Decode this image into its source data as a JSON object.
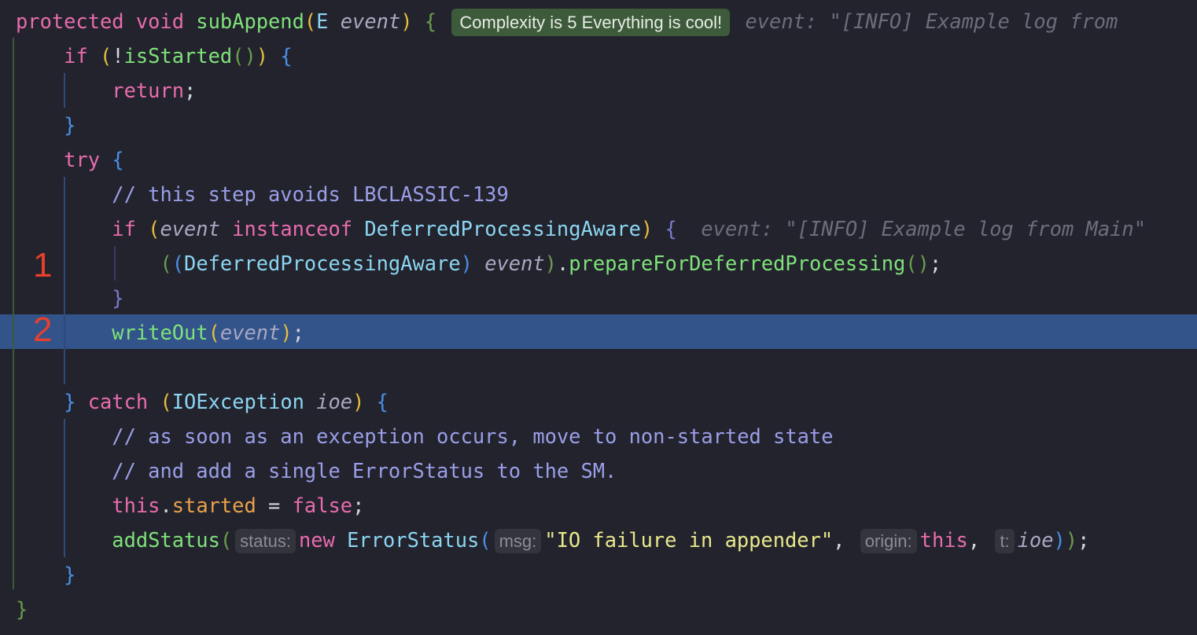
{
  "colors": {
    "background": "#23232d",
    "current_line": "#32548a",
    "marker": "#e8402c"
  },
  "markers": [
    "1",
    "2"
  ],
  "lines": [
    {
      "tokens": [
        {
          "c": "kw",
          "t": "protected void "
        },
        {
          "c": "fn",
          "t": "subAppend"
        },
        {
          "c": "b1",
          "t": "("
        },
        {
          "c": "ty",
          "t": "E "
        },
        {
          "c": "pa",
          "t": "event"
        },
        {
          "c": "b1",
          "t": ")"
        },
        {
          "c": "p",
          "t": " "
        },
        {
          "c": "b2",
          "t": "{"
        },
        {
          "c": "p",
          "t": " "
        },
        {
          "c": "badge",
          "t": "Complexity is 5 Everything is cool!"
        },
        {
          "c": "p",
          "t": " "
        },
        {
          "c": "gh",
          "t": "event: \"[INFO] Example log from"
        }
      ]
    },
    {
      "tokens": [
        {
          "c": "p",
          "t": "    "
        },
        {
          "c": "kw",
          "t": "if "
        },
        {
          "c": "b1",
          "t": "("
        },
        {
          "c": "p",
          "t": "!"
        },
        {
          "c": "fn",
          "t": "isStarted"
        },
        {
          "c": "b2",
          "t": "()"
        },
        {
          "c": "b1",
          "t": ")"
        },
        {
          "c": "p",
          "t": " "
        },
        {
          "c": "b3",
          "t": "{"
        }
      ]
    },
    {
      "tokens": [
        {
          "c": "p",
          "t": "        "
        },
        {
          "c": "kw",
          "t": "return"
        },
        {
          "c": "p",
          "t": ";"
        }
      ]
    },
    {
      "tokens": [
        {
          "c": "p",
          "t": "    "
        },
        {
          "c": "b3",
          "t": "}"
        }
      ]
    },
    {
      "tokens": [
        {
          "c": "p",
          "t": "    "
        },
        {
          "c": "kw",
          "t": "try "
        },
        {
          "c": "b3",
          "t": "{"
        }
      ]
    },
    {
      "tokens": [
        {
          "c": "p",
          "t": "        "
        },
        {
          "c": "cm",
          "t": "// this step avoids LBCLASSIC-139"
        }
      ]
    },
    {
      "tokens": [
        {
          "c": "p",
          "t": "        "
        },
        {
          "c": "kw",
          "t": "if "
        },
        {
          "c": "b1",
          "t": "("
        },
        {
          "c": "pa",
          "t": "event"
        },
        {
          "c": "kw",
          "t": " instanceof "
        },
        {
          "c": "ty",
          "t": "DeferredProcessingAware"
        },
        {
          "c": "b1",
          "t": ")"
        },
        {
          "c": "p",
          "t": " "
        },
        {
          "c": "b4",
          "t": "{"
        },
        {
          "c": "p",
          "t": "  "
        },
        {
          "c": "gh",
          "t": "event: \"[INFO] Example log from Main\""
        }
      ]
    },
    {
      "tokens": [
        {
          "c": "p",
          "t": "            "
        },
        {
          "c": "b2",
          "t": "("
        },
        {
          "c": "b3",
          "t": "("
        },
        {
          "c": "ty",
          "t": "DeferredProcessingAware"
        },
        {
          "c": "b3",
          "t": ")"
        },
        {
          "c": "p",
          "t": " "
        },
        {
          "c": "pa",
          "t": "event"
        },
        {
          "c": "b2",
          "t": ")"
        },
        {
          "c": "p",
          "t": "."
        },
        {
          "c": "fn",
          "t": "prepareForDeferredProcessing"
        },
        {
          "c": "b2",
          "t": "()"
        },
        {
          "c": "p",
          "t": ";"
        }
      ]
    },
    {
      "tokens": [
        {
          "c": "p",
          "t": "        "
        },
        {
          "c": "b4",
          "t": "}"
        }
      ]
    },
    {
      "tokens": [
        {
          "c": "p",
          "t": "        "
        },
        {
          "c": "fn",
          "t": "writeOut"
        },
        {
          "c": "b1",
          "t": "("
        },
        {
          "c": "pa",
          "t": "event"
        },
        {
          "c": "b1",
          "t": ")"
        },
        {
          "c": "p",
          "t": ";"
        }
      ]
    },
    {
      "tokens": []
    },
    {
      "tokens": [
        {
          "c": "p",
          "t": "    "
        },
        {
          "c": "b3",
          "t": "}"
        },
        {
          "c": "kw",
          "t": " catch "
        },
        {
          "c": "b1",
          "t": "("
        },
        {
          "c": "ty",
          "t": "IOException "
        },
        {
          "c": "pa",
          "t": "ioe"
        },
        {
          "c": "b1",
          "t": ")"
        },
        {
          "c": "p",
          "t": " "
        },
        {
          "c": "b3",
          "t": "{"
        }
      ]
    },
    {
      "tokens": [
        {
          "c": "p",
          "t": "        "
        },
        {
          "c": "cm",
          "t": "// as soon as an exception occurs, move to non-started state"
        }
      ]
    },
    {
      "tokens": [
        {
          "c": "p",
          "t": "        "
        },
        {
          "c": "cm",
          "t": "// and add a single ErrorStatus to the SM."
        }
      ]
    },
    {
      "tokens": [
        {
          "c": "p",
          "t": "        "
        },
        {
          "c": "kw",
          "t": "this"
        },
        {
          "c": "p",
          "t": "."
        },
        {
          "c": "fd",
          "t": "started"
        },
        {
          "c": "p",
          "t": " = "
        },
        {
          "c": "kw",
          "t": "false"
        },
        {
          "c": "p",
          "t": ";"
        }
      ]
    },
    {
      "tokens": [
        {
          "c": "p",
          "t": "        "
        },
        {
          "c": "fn",
          "t": "addStatus"
        },
        {
          "c": "b2",
          "t": "("
        },
        {
          "c": "hint",
          "t": "status:"
        },
        {
          "c": "kw",
          "t": "new "
        },
        {
          "c": "ty",
          "t": "ErrorStatus"
        },
        {
          "c": "b3",
          "t": "("
        },
        {
          "c": "hint",
          "t": "msg:"
        },
        {
          "c": "st",
          "t": "\"IO failure in appender\""
        },
        {
          "c": "p",
          "t": ", "
        },
        {
          "c": "hint",
          "t": "origin:"
        },
        {
          "c": "kw",
          "t": "this"
        },
        {
          "c": "p",
          "t": ", "
        },
        {
          "c": "hint",
          "t": "t:"
        },
        {
          "c": "pa",
          "t": "ioe"
        },
        {
          "c": "b3",
          "t": ")"
        },
        {
          "c": "b2",
          "t": ")"
        },
        {
          "c": "p",
          "t": ";"
        }
      ]
    },
    {
      "tokens": [
        {
          "c": "p",
          "t": "    "
        },
        {
          "c": "b3",
          "t": "}"
        }
      ]
    },
    {
      "tokens": [
        {
          "c": "b2",
          "t": "}"
        }
      ]
    }
  ]
}
